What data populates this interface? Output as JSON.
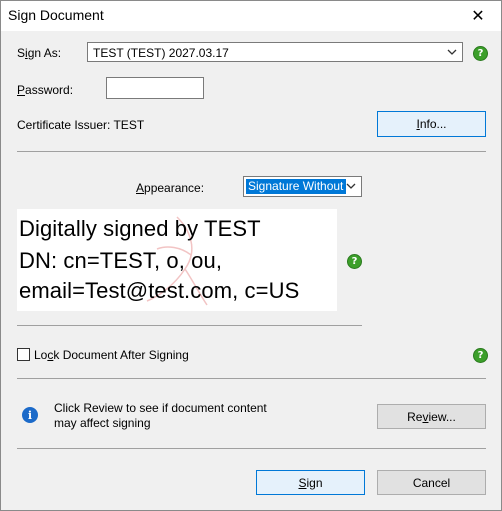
{
  "window": {
    "title": "Sign Document"
  },
  "sign_as": {
    "label_prefix": "S",
    "label_accel": "i",
    "label_rest": "gn As:",
    "value": "TEST (TEST) 2027.03.17"
  },
  "password": {
    "label_accel": "P",
    "label_rest": "assword:",
    "value": ""
  },
  "certificate": {
    "issuer_text": "Certificate Issuer: TEST",
    "info_accel": "I",
    "info_rest": "nfo..."
  },
  "appearance": {
    "label_accel": "A",
    "label_rest": "ppearance:",
    "value": "Signature Without"
  },
  "preview": {
    "line1": "Digitally signed by TEST",
    "line2": "DN: cn=TEST, o, ou,",
    "line3": "email=Test@test.com, c=US"
  },
  "lock": {
    "label_prefix": "Lo",
    "label_accel": "c",
    "label_rest": "k Document After Signing",
    "checked": false
  },
  "review": {
    "text1": "Click Review to see if document content",
    "text2": "may affect signing",
    "button_prefix": "Re",
    "button_accel": "v",
    "button_rest": "iew..."
  },
  "actions": {
    "sign_accel": "S",
    "sign_rest": "ign",
    "cancel": "Cancel"
  },
  "colors": {
    "help_green": "#3c9f2a",
    "info_blue": "#1b6ac9",
    "highlight": "#0078d7"
  },
  "icons": [
    "close-icon",
    "chevron-down-icon",
    "help-icon",
    "info-icon"
  ]
}
